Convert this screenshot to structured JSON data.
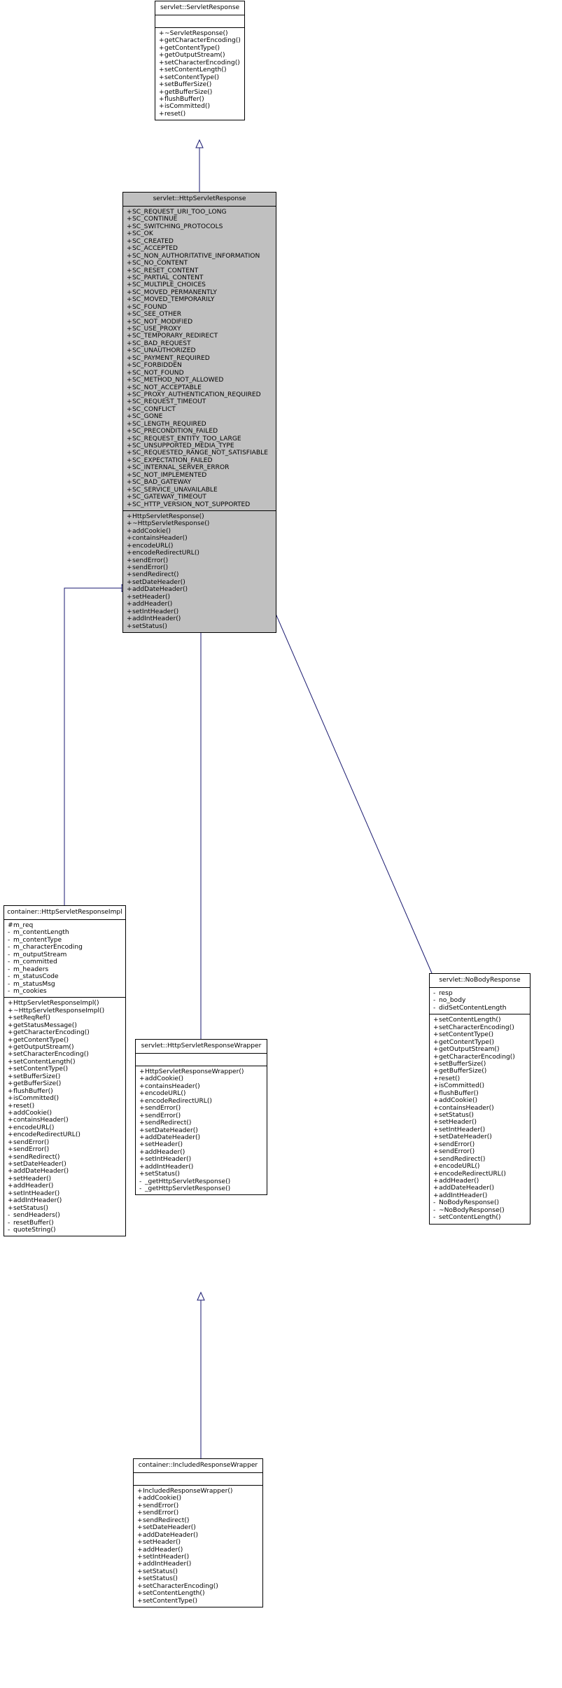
{
  "diagram": {
    "kind": "uml-class-inheritance",
    "edge_color": "#191970",
    "box_fill_highlight": "#c0c0c0",
    "box_fill_plain": "#ffffff",
    "border_color": "#000000"
  },
  "classes": {
    "servlet_ServletResponse": {
      "name": "servlet::ServletResponse",
      "attributes": [],
      "methods": [
        {
          "vis": "+",
          "sig": "~ServletResponse()"
        },
        {
          "vis": "+",
          "sig": "getCharacterEncoding()"
        },
        {
          "vis": "+",
          "sig": "getContentType()"
        },
        {
          "vis": "+",
          "sig": "getOutputStream()"
        },
        {
          "vis": "+",
          "sig": "setCharacterEncoding()"
        },
        {
          "vis": "+",
          "sig": "setContentLength()"
        },
        {
          "vis": "+",
          "sig": "setContentType()"
        },
        {
          "vis": "+",
          "sig": "setBufferSize()"
        },
        {
          "vis": "+",
          "sig": "getBufferSize()"
        },
        {
          "vis": "+",
          "sig": "flushBuffer()"
        },
        {
          "vis": "+",
          "sig": "isCommitted()"
        },
        {
          "vis": "+",
          "sig": "reset()"
        }
      ]
    },
    "servlet_HttpServletResponse": {
      "name": "servlet::HttpServletResponse",
      "attributes": [
        {
          "vis": "+",
          "sig": "SC_REQUEST_URI_TOO_LONG"
        },
        {
          "vis": "+",
          "sig": "SC_CONTINUE"
        },
        {
          "vis": "+",
          "sig": "SC_SWITCHING_PROTOCOLS"
        },
        {
          "vis": "+",
          "sig": "SC_OK"
        },
        {
          "vis": "+",
          "sig": "SC_CREATED"
        },
        {
          "vis": "+",
          "sig": "SC_ACCEPTED"
        },
        {
          "vis": "+",
          "sig": "SC_NON_AUTHORITATIVE_INFORMATION"
        },
        {
          "vis": "+",
          "sig": "SC_NO_CONTENT"
        },
        {
          "vis": "+",
          "sig": "SC_RESET_CONTENT"
        },
        {
          "vis": "+",
          "sig": "SC_PARTIAL_CONTENT"
        },
        {
          "vis": "+",
          "sig": "SC_MULTIPLE_CHOICES"
        },
        {
          "vis": "+",
          "sig": "SC_MOVED_PERMANENTLY"
        },
        {
          "vis": "+",
          "sig": "SC_MOVED_TEMPORARILY"
        },
        {
          "vis": "+",
          "sig": "SC_FOUND"
        },
        {
          "vis": "+",
          "sig": "SC_SEE_OTHER"
        },
        {
          "vis": "+",
          "sig": "SC_NOT_MODIFIED"
        },
        {
          "vis": "+",
          "sig": "SC_USE_PROXY"
        },
        {
          "vis": "+",
          "sig": "SC_TEMPORARY_REDIRECT"
        },
        {
          "vis": "+",
          "sig": "SC_BAD_REQUEST"
        },
        {
          "vis": "+",
          "sig": "SC_UNAUTHORIZED"
        },
        {
          "vis": "+",
          "sig": "SC_PAYMENT_REQUIRED"
        },
        {
          "vis": "+",
          "sig": "SC_FORBIDDEN"
        },
        {
          "vis": "+",
          "sig": "SC_NOT_FOUND"
        },
        {
          "vis": "+",
          "sig": "SC_METHOD_NOT_ALLOWED"
        },
        {
          "vis": "+",
          "sig": "SC_NOT_ACCEPTABLE"
        },
        {
          "vis": "+",
          "sig": "SC_PROXY_AUTHENTICATION_REQUIRED"
        },
        {
          "vis": "+",
          "sig": "SC_REQUEST_TIMEOUT"
        },
        {
          "vis": "+",
          "sig": "SC_CONFLICT"
        },
        {
          "vis": "+",
          "sig": "SC_GONE"
        },
        {
          "vis": "+",
          "sig": "SC_LENGTH_REQUIRED"
        },
        {
          "vis": "+",
          "sig": "SC_PRECONDITION_FAILED"
        },
        {
          "vis": "+",
          "sig": "SC_REQUEST_ENTITY_TOO_LARGE"
        },
        {
          "vis": "+",
          "sig": "SC_UNSUPPORTED_MEDIA_TYPE"
        },
        {
          "vis": "+",
          "sig": "SC_REQUESTED_RANGE_NOT_SATISFIABLE"
        },
        {
          "vis": "+",
          "sig": "SC_EXPECTATION_FAILED"
        },
        {
          "vis": "+",
          "sig": "SC_INTERNAL_SERVER_ERROR"
        },
        {
          "vis": "+",
          "sig": "SC_NOT_IMPLEMENTED"
        },
        {
          "vis": "+",
          "sig": "SC_BAD_GATEWAY"
        },
        {
          "vis": "+",
          "sig": "SC_SERVICE_UNAVAILABLE"
        },
        {
          "vis": "+",
          "sig": "SC_GATEWAY_TIMEOUT"
        },
        {
          "vis": "+",
          "sig": "SC_HTTP_VERSION_NOT_SUPPORTED"
        }
      ],
      "methods": [
        {
          "vis": "+",
          "sig": "HttpServletResponse()"
        },
        {
          "vis": "+",
          "sig": "~HttpServletResponse()"
        },
        {
          "vis": "+",
          "sig": "addCookie()"
        },
        {
          "vis": "+",
          "sig": "containsHeader()"
        },
        {
          "vis": "+",
          "sig": "encodeURL()"
        },
        {
          "vis": "+",
          "sig": "encodeRedirectURL()"
        },
        {
          "vis": "+",
          "sig": "sendError()"
        },
        {
          "vis": "+",
          "sig": "sendError()"
        },
        {
          "vis": "+",
          "sig": "sendRedirect()"
        },
        {
          "vis": "+",
          "sig": "setDateHeader()"
        },
        {
          "vis": "+",
          "sig": "addDateHeader()"
        },
        {
          "vis": "+",
          "sig": "setHeader()"
        },
        {
          "vis": "+",
          "sig": "addHeader()"
        },
        {
          "vis": "+",
          "sig": "setIntHeader()"
        },
        {
          "vis": "+",
          "sig": "addIntHeader()"
        },
        {
          "vis": "+",
          "sig": "setStatus()"
        }
      ]
    },
    "container_HttpServletResponseImpl": {
      "name": "container::HttpServletResponseImpl",
      "attributes": [
        {
          "vis": "#",
          "sig": "m_req"
        },
        {
          "vis": "-",
          "sig": "m_contentLength"
        },
        {
          "vis": "-",
          "sig": "m_contentType"
        },
        {
          "vis": "-",
          "sig": "m_characterEncoding"
        },
        {
          "vis": "-",
          "sig": "m_outputStream"
        },
        {
          "vis": "-",
          "sig": "m_committed"
        },
        {
          "vis": "-",
          "sig": "m_headers"
        },
        {
          "vis": "-",
          "sig": "m_statusCode"
        },
        {
          "vis": "-",
          "sig": "m_statusMsg"
        },
        {
          "vis": "-",
          "sig": "m_cookies"
        }
      ],
      "methods": [
        {
          "vis": "+",
          "sig": "HttpServletResponseImpl()"
        },
        {
          "vis": "+",
          "sig": "~HttpServletResponseImpl()"
        },
        {
          "vis": "+",
          "sig": "setReqRef()"
        },
        {
          "vis": "+",
          "sig": "getStatusMessage()"
        },
        {
          "vis": "+",
          "sig": "getCharacterEncoding()"
        },
        {
          "vis": "+",
          "sig": "getContentType()"
        },
        {
          "vis": "+",
          "sig": "getOutputStream()"
        },
        {
          "vis": "+",
          "sig": "setCharacterEncoding()"
        },
        {
          "vis": "+",
          "sig": "setContentLength()"
        },
        {
          "vis": "+",
          "sig": "setContentType()"
        },
        {
          "vis": "+",
          "sig": "setBufferSize()"
        },
        {
          "vis": "+",
          "sig": "getBufferSize()"
        },
        {
          "vis": "+",
          "sig": "flushBuffer()"
        },
        {
          "vis": "+",
          "sig": "isCommitted()"
        },
        {
          "vis": "+",
          "sig": "reset()"
        },
        {
          "vis": "+",
          "sig": "addCookie()"
        },
        {
          "vis": "+",
          "sig": "containsHeader()"
        },
        {
          "vis": "+",
          "sig": "encodeURL()"
        },
        {
          "vis": "+",
          "sig": "encodeRedirectURL()"
        },
        {
          "vis": "+",
          "sig": "sendError()"
        },
        {
          "vis": "+",
          "sig": "sendError()"
        },
        {
          "vis": "+",
          "sig": "sendRedirect()"
        },
        {
          "vis": "+",
          "sig": "setDateHeader()"
        },
        {
          "vis": "+",
          "sig": "addDateHeader()"
        },
        {
          "vis": "+",
          "sig": "setHeader()"
        },
        {
          "vis": "+",
          "sig": "addHeader()"
        },
        {
          "vis": "+",
          "sig": "setIntHeader()"
        },
        {
          "vis": "+",
          "sig": "addIntHeader()"
        },
        {
          "vis": "+",
          "sig": "setStatus()"
        },
        {
          "vis": "-",
          "sig": "sendHeaders()"
        },
        {
          "vis": "-",
          "sig": "resetBuffer()"
        },
        {
          "vis": "-",
          "sig": "quoteString()"
        }
      ]
    },
    "servlet_HttpServletResponseWrapper": {
      "name": "servlet::HttpServletResponseWrapper",
      "attributes": [],
      "methods": [
        {
          "vis": "+",
          "sig": "HttpServletResponseWrapper()"
        },
        {
          "vis": "+",
          "sig": "addCookie()"
        },
        {
          "vis": "+",
          "sig": "containsHeader()"
        },
        {
          "vis": "+",
          "sig": "encodeURL()"
        },
        {
          "vis": "+",
          "sig": "encodeRedirectURL()"
        },
        {
          "vis": "+",
          "sig": "sendError()"
        },
        {
          "vis": "+",
          "sig": "sendError()"
        },
        {
          "vis": "+",
          "sig": "sendRedirect()"
        },
        {
          "vis": "+",
          "sig": "setDateHeader()"
        },
        {
          "vis": "+",
          "sig": "addDateHeader()"
        },
        {
          "vis": "+",
          "sig": "setHeader()"
        },
        {
          "vis": "+",
          "sig": "addHeader()"
        },
        {
          "vis": "+",
          "sig": "setIntHeader()"
        },
        {
          "vis": "+",
          "sig": "addIntHeader()"
        },
        {
          "vis": "+",
          "sig": "setStatus()"
        },
        {
          "vis": "-",
          "sig": "_getHttpServletResponse()"
        },
        {
          "vis": "-",
          "sig": "_getHttpServletResponse()"
        }
      ]
    },
    "servlet_NoBodyResponse": {
      "name": "servlet::NoBodyResponse",
      "attributes": [
        {
          "vis": "-",
          "sig": "resp"
        },
        {
          "vis": "-",
          "sig": "no_body"
        },
        {
          "vis": "-",
          "sig": "didSetContentLength"
        }
      ],
      "methods": [
        {
          "vis": "+",
          "sig": "setContentLength()"
        },
        {
          "vis": "+",
          "sig": "setCharacterEncoding()"
        },
        {
          "vis": "+",
          "sig": "setContentType()"
        },
        {
          "vis": "+",
          "sig": "getContentType()"
        },
        {
          "vis": "+",
          "sig": "getOutputStream()"
        },
        {
          "vis": "+",
          "sig": "getCharacterEncoding()"
        },
        {
          "vis": "+",
          "sig": "setBufferSize()"
        },
        {
          "vis": "+",
          "sig": "getBufferSize()"
        },
        {
          "vis": "+",
          "sig": "reset()"
        },
        {
          "vis": "+",
          "sig": "isCommitted()"
        },
        {
          "vis": "+",
          "sig": "flushBuffer()"
        },
        {
          "vis": "+",
          "sig": "addCookie()"
        },
        {
          "vis": "+",
          "sig": "containsHeader()"
        },
        {
          "vis": "+",
          "sig": "setStatus()"
        },
        {
          "vis": "+",
          "sig": "setHeader()"
        },
        {
          "vis": "+",
          "sig": "setIntHeader()"
        },
        {
          "vis": "+",
          "sig": "setDateHeader()"
        },
        {
          "vis": "+",
          "sig": "sendError()"
        },
        {
          "vis": "+",
          "sig": "sendError()"
        },
        {
          "vis": "+",
          "sig": "sendRedirect()"
        },
        {
          "vis": "+",
          "sig": "encodeURL()"
        },
        {
          "vis": "+",
          "sig": "encodeRedirectURL()"
        },
        {
          "vis": "+",
          "sig": "addHeader()"
        },
        {
          "vis": "+",
          "sig": "addDateHeader()"
        },
        {
          "vis": "+",
          "sig": "addIntHeader()"
        },
        {
          "vis": "-",
          "sig": "NoBodyResponse()"
        },
        {
          "vis": "-",
          "sig": "~NoBodyResponse()"
        },
        {
          "vis": "-",
          "sig": "setContentLength()"
        }
      ]
    },
    "container_IncludedResponseWrapper": {
      "name": "container::IncludedResponseWrapper",
      "attributes": [],
      "methods": [
        {
          "vis": "+",
          "sig": "IncludedResponseWrapper()"
        },
        {
          "vis": "+",
          "sig": "addCookie()"
        },
        {
          "vis": "+",
          "sig": "sendError()"
        },
        {
          "vis": "+",
          "sig": "sendError()"
        },
        {
          "vis": "+",
          "sig": "sendRedirect()"
        },
        {
          "vis": "+",
          "sig": "setDateHeader()"
        },
        {
          "vis": "+",
          "sig": "addDateHeader()"
        },
        {
          "vis": "+",
          "sig": "setHeader()"
        },
        {
          "vis": "+",
          "sig": "addHeader()"
        },
        {
          "vis": "+",
          "sig": "setIntHeader()"
        },
        {
          "vis": "+",
          "sig": "addIntHeader()"
        },
        {
          "vis": "+",
          "sig": "setStatus()"
        },
        {
          "vis": "+",
          "sig": "setStatus()"
        },
        {
          "vis": "+",
          "sig": "setCharacterEncoding()"
        },
        {
          "vis": "+",
          "sig": "setContentLength()"
        },
        {
          "vis": "+",
          "sig": "setContentType()"
        }
      ]
    }
  },
  "inheritance_edges": [
    {
      "from": "servlet_HttpServletResponse",
      "to": "servlet_ServletResponse"
    },
    {
      "from": "container_HttpServletResponseImpl",
      "to": "servlet_HttpServletResponse"
    },
    {
      "from": "servlet_HttpServletResponseWrapper",
      "to": "servlet_HttpServletResponse"
    },
    {
      "from": "servlet_NoBodyResponse",
      "to": "servlet_HttpServletResponse"
    },
    {
      "from": "container_IncludedResponseWrapper",
      "to": "servlet_HttpServletResponseWrapper"
    }
  ]
}
